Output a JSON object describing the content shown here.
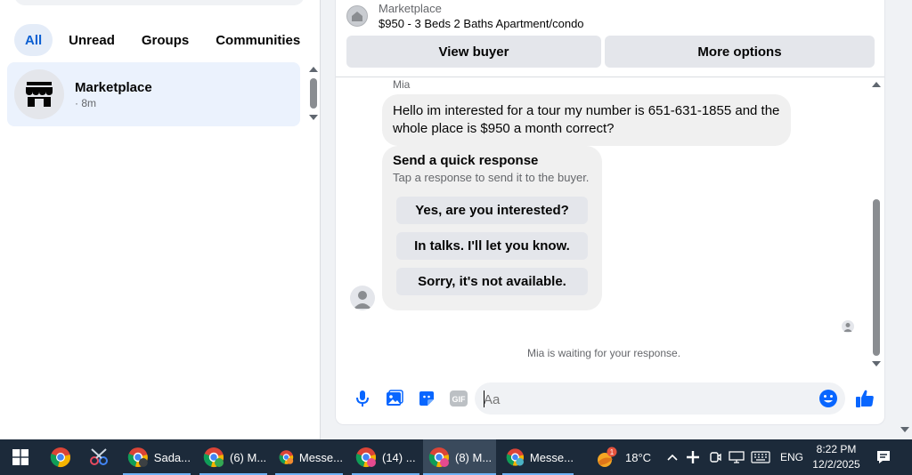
{
  "filters": [
    "All",
    "Unread",
    "Groups",
    "Communities"
  ],
  "active_filter": "All",
  "conversation": {
    "name": "Marketplace",
    "time": "· 8m"
  },
  "listing": {
    "kind": "Marketplace",
    "title": "$950 - 3 Beds 2 Baths Apartment/condo"
  },
  "header_buttons": {
    "view_buyer": "View buyer",
    "more_options": "More options"
  },
  "messages": {
    "sender": "Mia",
    "text": "Hello im interested for a tour my number is 651-631-1855 and the whole place is $950 a month correct?"
  },
  "quick_response": {
    "title": "Send a quick response",
    "subtitle": "Tap a response to send it to the buyer.",
    "options": [
      "Yes, are you interested?",
      "In talks. I'll let you know.",
      "Sorry, it's not available."
    ]
  },
  "status_text": "Mia is waiting for your response.",
  "composer": {
    "placeholder": "Aa"
  },
  "icons": [
    "microphone-icon",
    "photo-icon",
    "sticker-icon",
    "gif-icon",
    "emoji-icon",
    "thumbs-up-icon"
  ],
  "colors": {
    "accent": "#0866ff",
    "active_chip_bg": "#e4ecf8",
    "selected_row_bg": "#ebf2fd",
    "taskbar": "#1c2a3a"
  },
  "taskbar": {
    "apps": [
      {
        "label": ""
      },
      {
        "label": ""
      },
      {
        "label": "Sada..."
      },
      {
        "label": "(6) M..."
      },
      {
        "label": "Messe..."
      },
      {
        "label": "(14) ..."
      },
      {
        "label": "(8) M..."
      },
      {
        "label": "Messe..."
      }
    ],
    "weather": {
      "badge": "1",
      "temp": "18°C"
    },
    "language": "ENG",
    "time": "8:22 PM",
    "date": "12/2/2025"
  }
}
